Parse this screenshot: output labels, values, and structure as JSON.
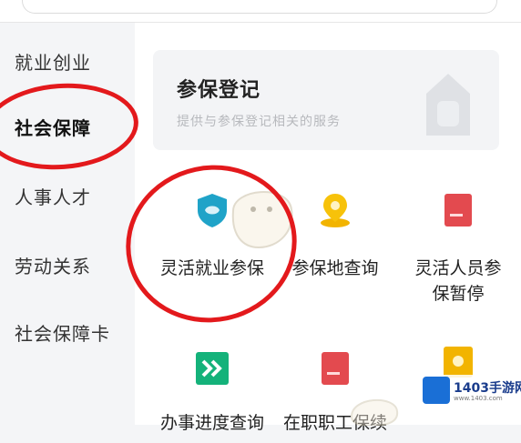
{
  "sidebar": {
    "items": [
      {
        "label": "就业创业"
      },
      {
        "label": "社会保障"
      },
      {
        "label": "人事人才"
      },
      {
        "label": "劳动关系"
      },
      {
        "label": "社会保障卡"
      }
    ],
    "active_index": 1
  },
  "banner": {
    "title": "参保登记",
    "subtitle": "提供与参保登记相关的服务"
  },
  "services": [
    {
      "label": "灵活就业参保",
      "icon": "shield-icon",
      "color": "#1fa3c8"
    },
    {
      "label": "参保地查询",
      "icon": "location-pin-icon",
      "color": "#f2b400"
    },
    {
      "label": "灵活人员参保暂停",
      "icon": "document-red-icon",
      "color": "#e34a4f"
    },
    {
      "label": "办事进度查询",
      "icon": "double-chevron-icon",
      "color": "#14b27a"
    },
    {
      "label": "在职职工保续",
      "icon": "document-red-icon",
      "color": "#e34a4f"
    },
    {
      "label": "",
      "icon": "document-yellow-icon",
      "color": "#f2b400"
    }
  ],
  "watermark": {
    "text": "1403手游网",
    "small": "www.1403.com"
  },
  "colors": {
    "highlight": "#e3191c",
    "accent_blue": "#1a6fd6"
  }
}
